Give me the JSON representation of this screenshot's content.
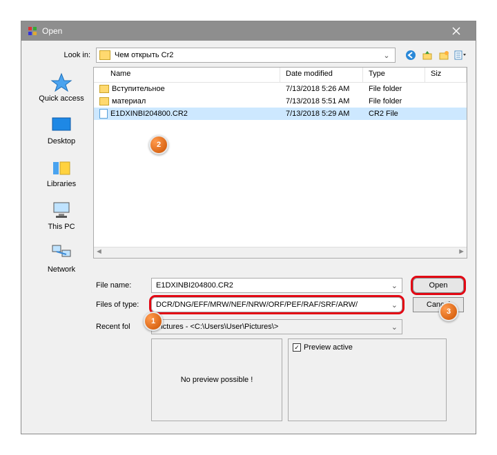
{
  "window": {
    "title": "Open"
  },
  "lookin": {
    "label": "Look in:",
    "value": "Чем открыть Cr2"
  },
  "columns": {
    "name": "Name",
    "date": "Date modified",
    "type": "Type",
    "size": "Siz"
  },
  "files": [
    {
      "name": "Вступительное",
      "date": "7/13/2018 5:26 AM",
      "type": "File folder",
      "kind": "folder",
      "selected": false
    },
    {
      "name": "материал",
      "date": "7/13/2018 5:51 AM",
      "type": "File folder",
      "kind": "folder",
      "selected": false
    },
    {
      "name": "E1DXINBI204800.CR2",
      "date": "7/13/2018 5:29 AM",
      "type": "CR2 File",
      "kind": "file",
      "selected": true
    }
  ],
  "places": {
    "quick": "Quick access",
    "desktop": "Desktop",
    "libraries": "Libraries",
    "thispc": "This PC",
    "network": "Network"
  },
  "form": {
    "filename_label": "File name:",
    "filename_value": "E1DXINBI204800.CR2",
    "filter_label": "Files of type:",
    "filter_value": "DCR/DNG/EFF/MRW/NEF/NRW/ORF/PEF/RAF/SRF/ARW/",
    "recent_label": "Recent fol",
    "recent_value": "Pictures  -  <C:\\Users\\User\\Pictures\\>",
    "open": "Open",
    "cancel": "Cancel"
  },
  "preview": {
    "none": "No preview possible !",
    "active": "Preview active"
  },
  "badges": {
    "b1": "1",
    "b2": "2",
    "b3": "3"
  }
}
